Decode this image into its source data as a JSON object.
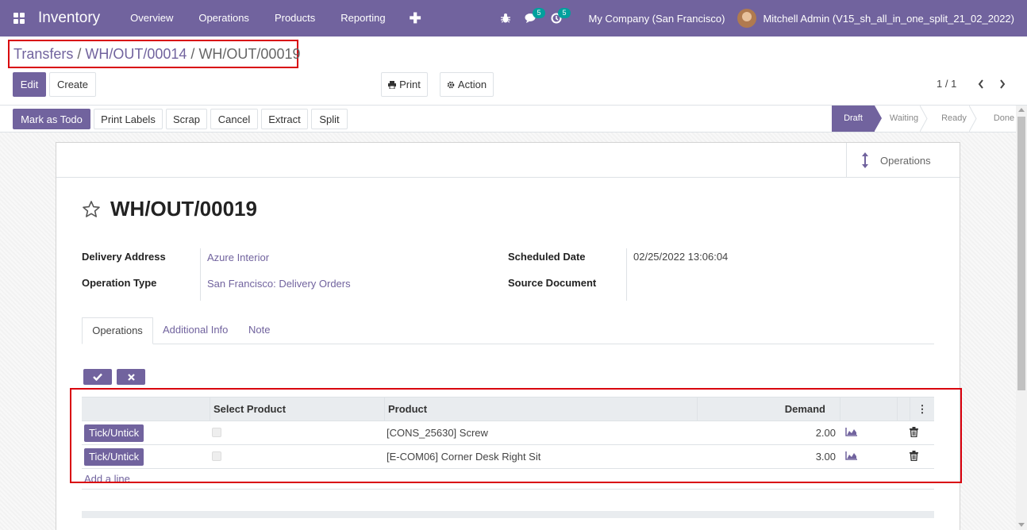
{
  "navbar": {
    "app_title": "Inventory",
    "menu": [
      "Overview",
      "Operations",
      "Products",
      "Reporting"
    ],
    "plus": "✚",
    "messages_badge": "5",
    "activity_badge": "5",
    "company": "My Company (San Francisco)",
    "user": "Mitchell Admin (V15_sh_all_in_one_split_21_02_2022)"
  },
  "breadcrumb": {
    "items": [
      "Transfers",
      "WH/OUT/00014"
    ],
    "separator": "/",
    "current": "WH/OUT/00019"
  },
  "control": {
    "edit": "Edit",
    "create": "Create",
    "print": "Print",
    "action": "Action",
    "pager": "1 / 1"
  },
  "statusbar": {
    "buttons": [
      "Mark as Todo",
      "Print Labels",
      "Scrap",
      "Cancel",
      "Extract",
      "Split"
    ],
    "stages": [
      "Draft",
      "Waiting",
      "Ready",
      "Done"
    ],
    "active_stage": "Draft"
  },
  "sheet": {
    "stat_button": "Operations",
    "title": "WH/OUT/00019",
    "fields": {
      "delivery_address_label": "Delivery Address",
      "delivery_address": "Azure Interior",
      "operation_type_label": "Operation Type",
      "operation_type": "San Francisco: Delivery Orders",
      "scheduled_date_label": "Scheduled Date",
      "scheduled_date": "02/25/2022 13:06:04",
      "source_document_label": "Source Document",
      "source_document": ""
    },
    "tabs": [
      "Operations",
      "Additional Info",
      "Note"
    ],
    "active_tab": "Operations"
  },
  "table": {
    "headers": [
      "",
      "Select Product",
      "Product",
      "Demand",
      "",
      "",
      "⋮"
    ],
    "rows": [
      {
        "button": "Tick/Untick",
        "product": "[CONS_25630] Screw",
        "demand": "2.00"
      },
      {
        "button": "Tick/Untick",
        "product": "[E-COM06] Corner Desk Right Sit",
        "demand": "3.00"
      }
    ],
    "add_line": "Add a line"
  },
  "colors": {
    "brand": "#71639e",
    "highlight": "#d9000d",
    "badge": "#00a09d"
  }
}
